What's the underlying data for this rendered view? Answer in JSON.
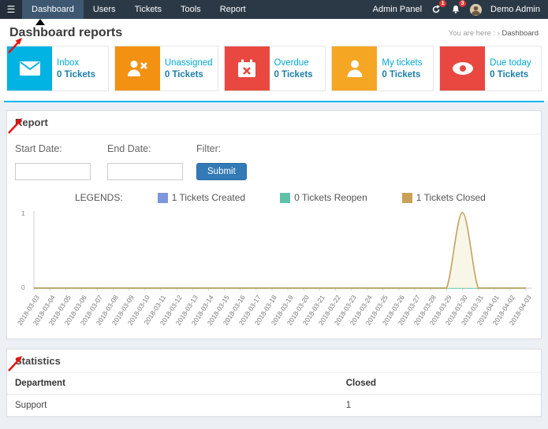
{
  "navbar": {
    "menu_items": [
      {
        "label": "Dashboard",
        "active": true
      },
      {
        "label": "Users",
        "active": false
      },
      {
        "label": "Tickets",
        "active": false
      },
      {
        "label": "Tools",
        "active": false
      },
      {
        "label": "Report",
        "active": false
      }
    ],
    "admin_panel_label": "Admin Panel",
    "refresh_badge": "1",
    "notification_badge": "3",
    "user_name": "Demo Admin"
  },
  "page_header": {
    "title": "Dashboard reports",
    "breadcrumb": {
      "prefix": "You are here :",
      "separator": "›",
      "current": "Dashboard"
    }
  },
  "stat_boxes": [
    {
      "label": "Inbox",
      "count": "0 Tickets",
      "color": "#00b3e3",
      "icon": "envelope-icon"
    },
    {
      "label": "Unassigned",
      "count": "0 Tickets",
      "color": "#f39112",
      "icon": "user-x-icon"
    },
    {
      "label": "Overdue",
      "count": "0 Tickets",
      "color": "#e8483f",
      "icon": "calendar-x-icon"
    },
    {
      "label": "My tickets",
      "count": "0 Tickets",
      "color": "#f5a623",
      "icon": "user-icon"
    },
    {
      "label": "Due today",
      "count": "0 Tickets",
      "color": "#e8483f",
      "icon": "eye-icon"
    }
  ],
  "report_panel": {
    "title": "Report",
    "form": {
      "start_date_label": "Start Date:",
      "end_date_label": "End Date:",
      "filter_label": "Filter:",
      "start_date_value": "",
      "end_date_value": "",
      "submit_label": "Submit"
    },
    "legend_title": "LEGENDS:",
    "legend_items": [
      {
        "label": "1 Tickets Created",
        "color": "#7b96dc"
      },
      {
        "label": "0 Tickets Reopen",
        "color": "#5fc2a7"
      },
      {
        "label": "1 Tickets Closed",
        "color": "#c7a258"
      }
    ]
  },
  "chart_data": {
    "type": "area",
    "title": "",
    "xlabel": "",
    "ylabel": "",
    "ylim": [
      0,
      1
    ],
    "grid": false,
    "legend_position": "top",
    "x": [
      "2018-03-03",
      "2018-03-04",
      "2018-03-05",
      "2018-03-06",
      "2018-03-07",
      "2018-03-08",
      "2018-03-09",
      "2018-03-10",
      "2018-03-11",
      "2018-03-12",
      "2018-03-13",
      "2018-03-14",
      "2018-03-15",
      "2018-03-16",
      "2018-03-17",
      "2018-03-18",
      "2018-03-19",
      "2018-03-20",
      "2018-03-21",
      "2018-03-22",
      "2018-03-23",
      "2018-03-24",
      "2018-03-25",
      "2018-03-26",
      "2018-03-27",
      "2018-03-28",
      "2018-03-29",
      "2018-03-30",
      "2018-03-31",
      "2018-04-01",
      "2018-04-02",
      "2018-04-03"
    ],
    "series": [
      {
        "name": "Tickets Created",
        "color": "#7b96dc",
        "values": [
          0,
          0,
          0,
          0,
          0,
          0,
          0,
          0,
          0,
          0,
          0,
          0,
          0,
          0,
          0,
          0,
          0,
          0,
          0,
          0,
          0,
          0,
          0,
          0,
          0,
          0,
          0,
          1,
          0,
          0,
          0,
          0
        ]
      },
      {
        "name": "Tickets Reopen",
        "color": "#5fc2a7",
        "values": [
          0,
          0,
          0,
          0,
          0,
          0,
          0,
          0,
          0,
          0,
          0,
          0,
          0,
          0,
          0,
          0,
          0,
          0,
          0,
          0,
          0,
          0,
          0,
          0,
          0,
          0,
          0,
          0,
          0,
          0,
          0,
          0
        ]
      },
      {
        "name": "Tickets Closed",
        "color": "#c7a258",
        "fill": "#f6f4e0",
        "values": [
          0,
          0,
          0,
          0,
          0,
          0,
          0,
          0,
          0,
          0,
          0,
          0,
          0,
          0,
          0,
          0,
          0,
          0,
          0,
          0,
          0,
          0,
          0,
          0,
          0,
          0,
          0,
          1,
          0,
          0,
          0,
          0
        ]
      }
    ]
  },
  "statistics_panel": {
    "title": "Statistics",
    "table": {
      "headers": [
        "Department",
        "Closed"
      ],
      "rows": [
        [
          "Support",
          "1"
        ]
      ]
    }
  }
}
